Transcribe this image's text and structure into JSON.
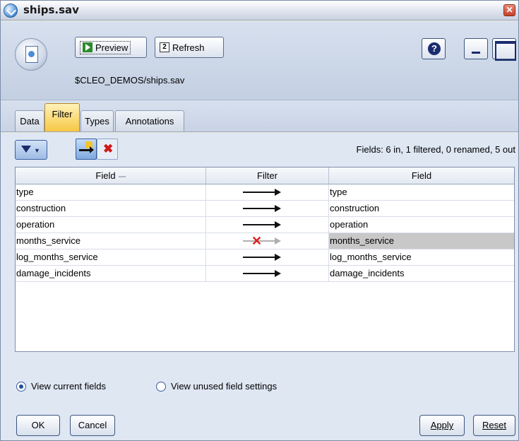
{
  "window": {
    "title": "ships.sav"
  },
  "toolbar": {
    "preview_label": "Preview",
    "refresh_label": "Refresh",
    "help_label": "?",
    "path": "$CLEO_DEMOS/ships.sav"
  },
  "tabs": [
    {
      "label": "Data",
      "active": false
    },
    {
      "label": "Filter",
      "active": true
    },
    {
      "label": "Types",
      "active": false
    },
    {
      "label": "Annotations",
      "active": false
    }
  ],
  "filter_panel": {
    "summary": "Fields: 6 in, 1 filtered, 0 renamed, 5 out",
    "columns": [
      "Field",
      "Filter",
      "Field"
    ],
    "rows": [
      {
        "field": "type",
        "filter": "pass",
        "output": "type"
      },
      {
        "field": "construction",
        "filter": "pass",
        "output": "construction"
      },
      {
        "field": "operation",
        "filter": "pass",
        "output": "operation"
      },
      {
        "field": "months_service",
        "filter": "filtered",
        "output": "months_service"
      },
      {
        "field": "log_months_service",
        "filter": "pass",
        "output": "log_months_service"
      },
      {
        "field": "damage_incidents",
        "filter": "pass",
        "output": "damage_incidents"
      }
    ]
  },
  "view_options": {
    "current_fields_label": "View current fields",
    "unused_fields_label": "View unused field settings",
    "selected": "current"
  },
  "buttons": {
    "ok": "OK",
    "cancel": "Cancel",
    "apply": "Apply",
    "reset": "Reset"
  },
  "colors": {
    "active_tab": "#f7c744",
    "filter_x": "#e31d1d",
    "selected_cell": "#c8c8c8"
  }
}
